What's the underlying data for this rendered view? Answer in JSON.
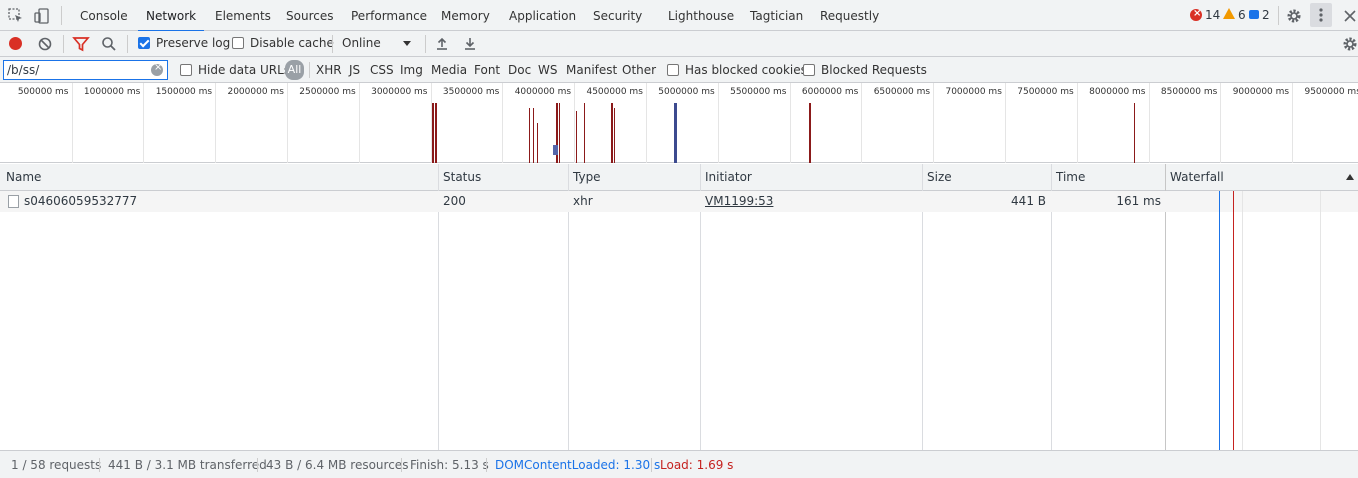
{
  "tabs": {
    "console": "Console",
    "network": "Network",
    "elements": "Elements",
    "sources": "Sources",
    "performance": "Performance",
    "memory": "Memory",
    "application": "Application",
    "security": "Security",
    "lighthouse": "Lighthouse",
    "tagtician": "Tagtician",
    "requestly": "Requestly",
    "active": "Network"
  },
  "counters": {
    "errors": "14",
    "warnings": "6",
    "messages": "2"
  },
  "toolbar": {
    "preserve_log": "Preserve log",
    "preserve_log_checked": true,
    "disable_cache": "Disable cache",
    "throttling": "Online"
  },
  "filter": {
    "value": "/b/ss/",
    "hide_data_urls": "Hide data URLs",
    "types": [
      "All",
      "XHR",
      "JS",
      "CSS",
      "Img",
      "Media",
      "Font",
      "Doc",
      "WS",
      "Manifest",
      "Other"
    ],
    "has_blocked_cookies": "Has blocked cookies",
    "blocked_requests": "Blocked Requests"
  },
  "timeline": {
    "ticks": [
      "500000 ms",
      "1000000 ms",
      "1500000 ms",
      "2000000 ms",
      "2500000 ms",
      "3000000 ms",
      "3500000 ms",
      "4000000 ms",
      "4500000 ms",
      "5000000 ms",
      "5500000 ms",
      "6000000 ms",
      "6500000 ms",
      "7000000 ms",
      "7500000 ms",
      "8000000 ms",
      "8500000 ms",
      "9000000 ms",
      "9500000 ms"
    ]
  },
  "table": {
    "columns": [
      "Name",
      "Status",
      "Type",
      "Initiator",
      "Size",
      "Time",
      "Waterfall"
    ],
    "rows": [
      {
        "name": "s04606059532777",
        "status": "200",
        "type": "xhr",
        "initiator": "VM1199:53",
        "size": "441 B",
        "time": "161 ms"
      }
    ]
  },
  "status": {
    "requests": "1 / 58 requests",
    "transferred": "441 B / 3.1 MB transferred",
    "resources": "43 B / 6.4 MB resources",
    "finish": "Finish: 5.13 s",
    "dom_content_loaded": "DOMContentLoaded: 1.30 s",
    "load": "Load: 1.69 s"
  },
  "colors": {
    "accent": "#1a73e8",
    "record": "#d93025",
    "dom_content_loaded": "#1a73e8",
    "load": "#c5221f",
    "event_marks": "#8b1a1a"
  }
}
